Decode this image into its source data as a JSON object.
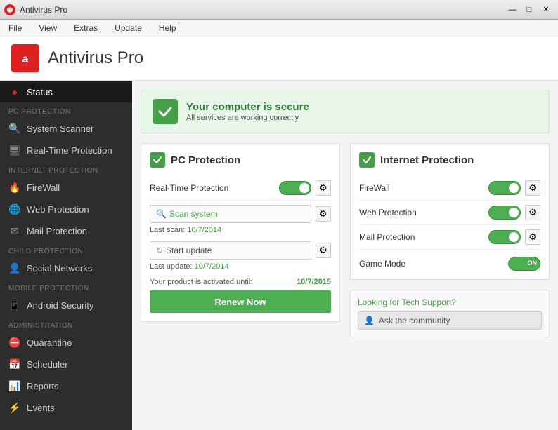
{
  "titlebar": {
    "title": "Antivirus Pro",
    "min": "—",
    "max": "□",
    "close": "✕"
  },
  "menubar": {
    "items": [
      "File",
      "View",
      "Extras",
      "Update",
      "Help"
    ]
  },
  "header": {
    "title": "Antivirus Pro"
  },
  "sidebar": {
    "status_label": "Status",
    "pc_section": "PC PROTECTION",
    "pc_items": [
      "System Scanner",
      "Real-Time Protection"
    ],
    "internet_section": "INTERNET PROTECTION",
    "internet_items": [
      "FireWall",
      "Web Protection",
      "Mail Protection"
    ],
    "child_section": "CHILD PROTECTION",
    "child_items": [
      "Social Networks"
    ],
    "mobile_section": "MOBILE PROTECTION",
    "mobile_items": [
      "Android Security"
    ],
    "admin_section": "ADMINISTRATION",
    "admin_items": [
      "Quarantine",
      "Scheduler",
      "Reports",
      "Events"
    ]
  },
  "status": {
    "title": "Your computer is secure",
    "subtitle": "All services are working correctly"
  },
  "pc_protection": {
    "title": "PC Protection",
    "realtime_label": "Real-Time Protection",
    "scan_placeholder": "Scan system",
    "last_scan_label": "Last scan:",
    "last_scan_date": "10/7/2014",
    "update_label": "Start update",
    "last_update_label": "Last update:",
    "last_update_date": "10/7/2014",
    "activation_label": "Your product is activated until:",
    "activation_date": "10/7/2015",
    "renew_label": "Renew Now"
  },
  "internet_protection": {
    "title": "Internet Protection",
    "firewall_label": "FireWall",
    "webprotect_label": "Web Protection",
    "mailprotect_label": "Mail Protection",
    "gamemode_label": "Game Mode"
  },
  "support": {
    "title_part1": "Looking for",
    "title_tech": "Tech",
    "title_part2": "Support?",
    "community_label": "Ask the community"
  }
}
